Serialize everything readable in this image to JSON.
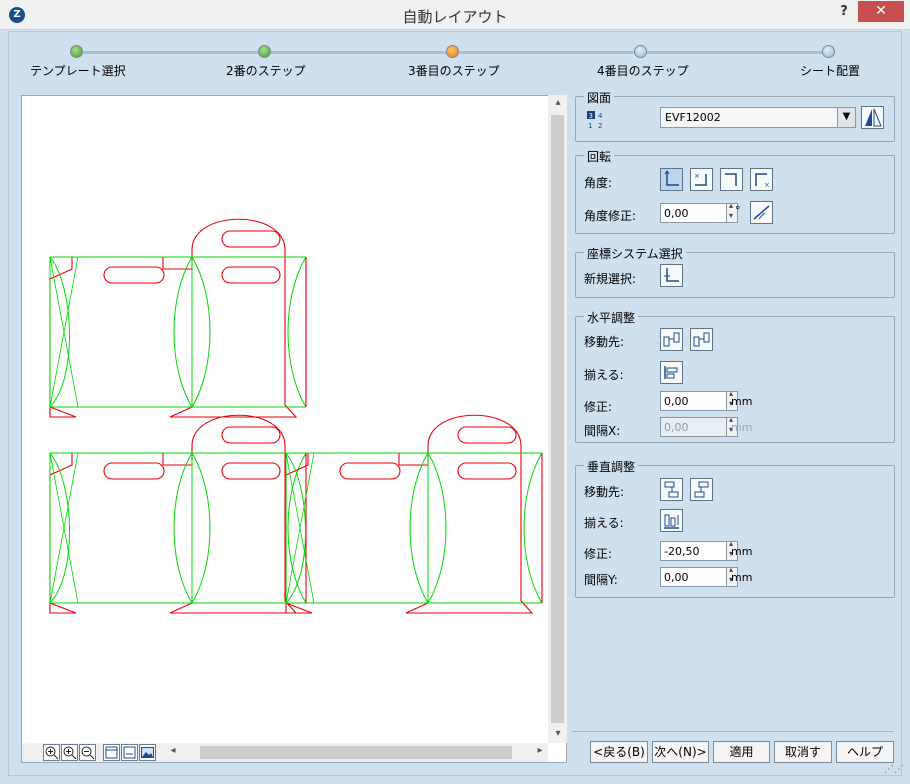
{
  "window": {
    "title": "自動レイアウト",
    "help": "?",
    "close": "✕",
    "app_icon": "Z"
  },
  "steps": [
    {
      "label": "テンプレート選択",
      "state": "done"
    },
    {
      "label": "2番のステップ",
      "state": "done"
    },
    {
      "label": "3番目のステップ",
      "state": "current"
    },
    {
      "label": "4番目のステップ",
      "state": "todo"
    },
    {
      "label": "シート配置",
      "state": "todo"
    }
  ],
  "drawing_group": {
    "title": "図面",
    "selected": "EVF12002",
    "layout_icon_text": "3 4 1 2"
  },
  "rotation_group": {
    "title": "回転",
    "angle_label": "角度:",
    "correction_label": "角度修正:",
    "correction_value": "0,00",
    "correction_unit": "°"
  },
  "coord_group": {
    "title": "座標システム選択",
    "new_select_label": "新規選択:"
  },
  "horizontal_group": {
    "title": "水平調整",
    "move_label": "移動先:",
    "align_label": "揃える:",
    "correction_label": "修正:",
    "correction_value": "0,00",
    "correction_unit": "mm",
    "spacing_label": "間隔X:",
    "spacing_value": "0,00",
    "spacing_unit": "mm"
  },
  "vertical_group": {
    "title": "垂直調整",
    "move_label": "移動先:",
    "align_label": "揃える:",
    "correction_label": "修正:",
    "correction_value": "-20,50",
    "correction_unit": "mm",
    "spacing_label": "間隔Y:",
    "spacing_value": "0,00",
    "spacing_unit": "mm"
  },
  "footer": {
    "back": "<戻る(B)",
    "next": "次へ(N)>",
    "apply": "適用",
    "cancel": "取消す",
    "help": "ヘルプ"
  },
  "colors": {
    "cut_line": "#e8000b",
    "crease_line": "#00d700",
    "accent": "#e67e10"
  }
}
